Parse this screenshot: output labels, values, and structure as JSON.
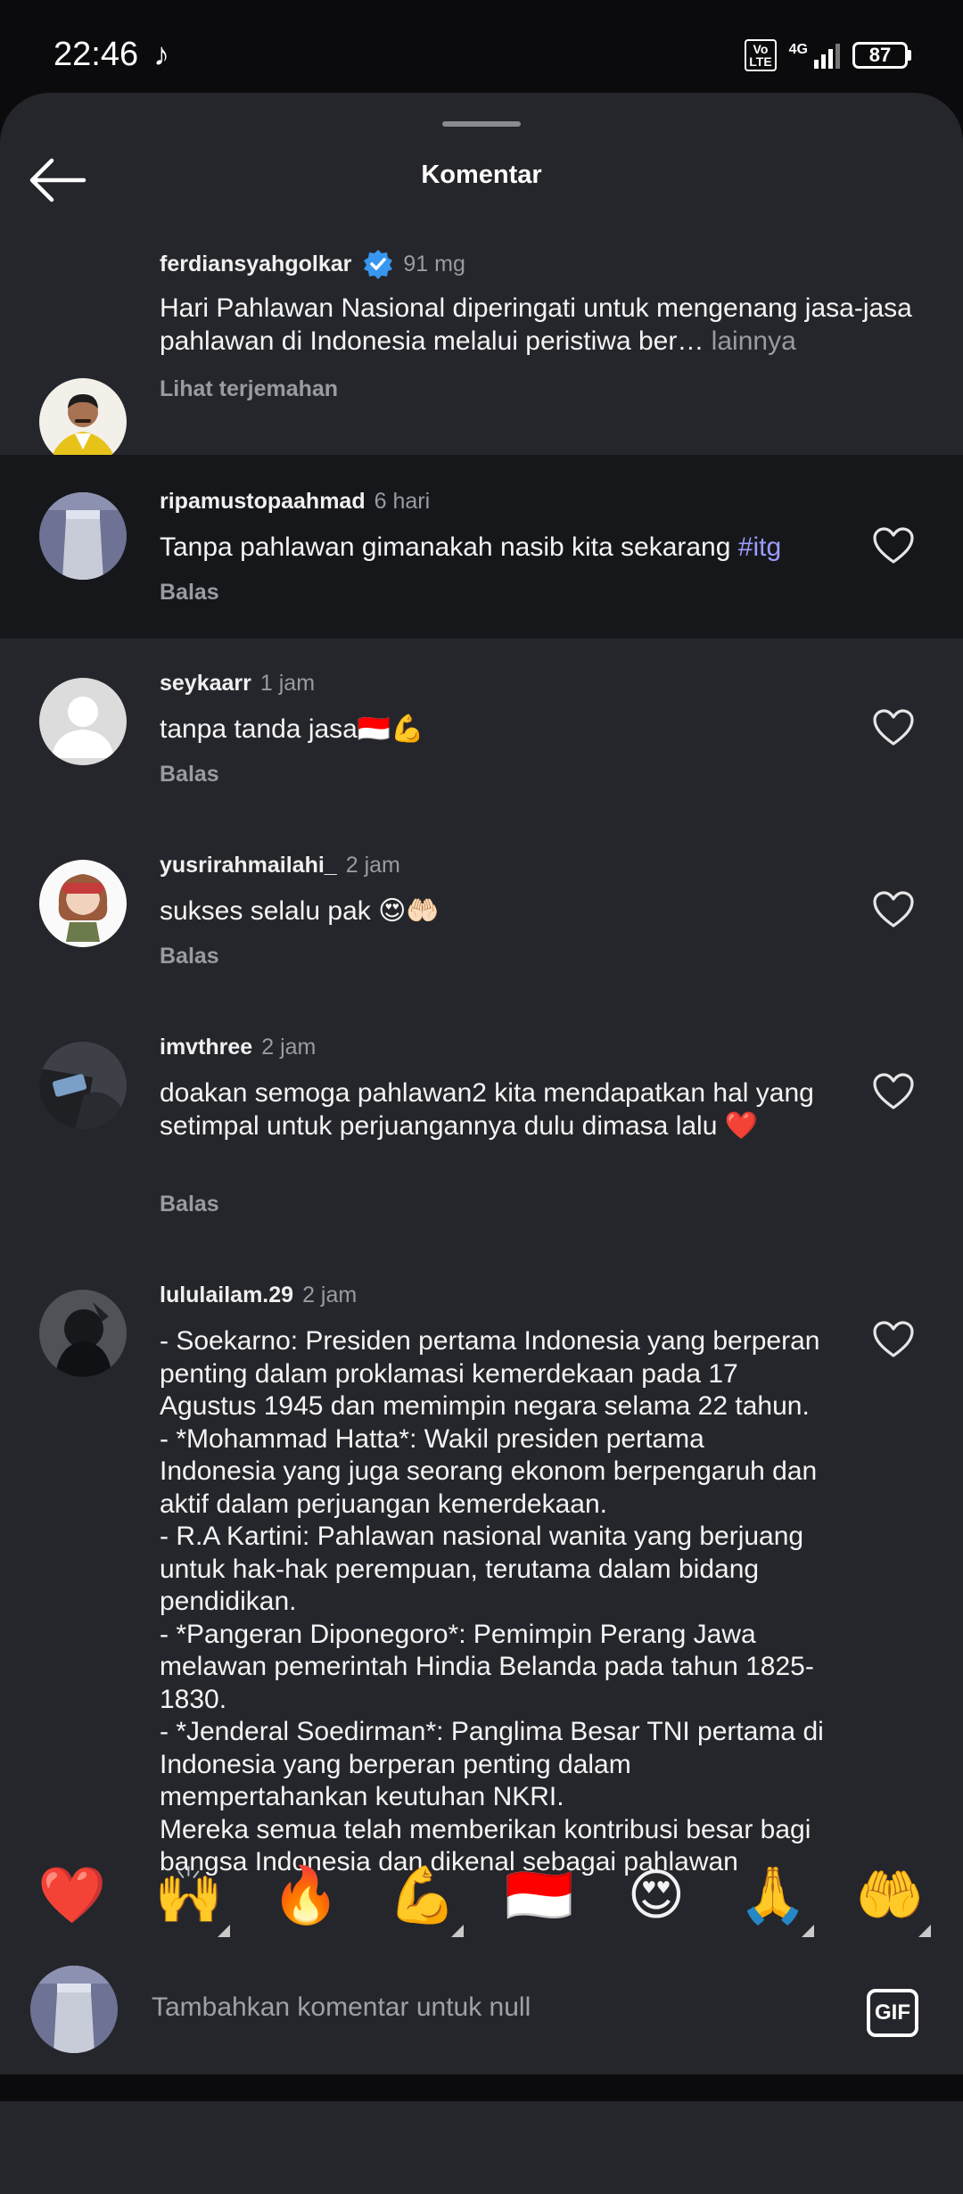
{
  "status_bar": {
    "time": "22:46",
    "network_label": "4G",
    "volte": "Vo LTE",
    "battery": "87"
  },
  "header": {
    "title": "Komentar"
  },
  "caption": {
    "username": "ferdiansyahgolkar",
    "time": "91 mg",
    "text": "Hari Pahlawan Nasional diperingati untuk mengenang jasa-jasa pahlawan di Indonesia melalui peristiwa ber…",
    "more": " lainnya",
    "translate": "Lihat terjemahan"
  },
  "comments": [
    {
      "username": "ripamustopaahmad",
      "time": "6 hari",
      "text": "Tanpa pahlawan gimanakah nasib kita sekarang ",
      "hashtag": "#itg",
      "reply": "Balas"
    },
    {
      "username": "seykaarr",
      "time": "1 jam",
      "text": "tanpa tanda jasa🇮🇩💪",
      "reply": "Balas"
    },
    {
      "username": "yusrirahmailahi_",
      "time": "2 jam",
      "text": "sukses selalu pak 😍🤲🏻",
      "reply": "Balas"
    },
    {
      "username": "imvthree",
      "time": "2 jam",
      "text": "doakan semoga pahlawan2 kita mendapatkan hal yang setimpal untuk perjuangannya dulu dimasa lalu ❤️",
      "reply": "Balas"
    },
    {
      "username": "lululailam.29",
      "time": "2 jam",
      "lines": [
        "- Soekarno: Presiden pertama Indonesia yang berperan penting dalam proklamasi kemerdekaan pada 17 Agustus 1945 dan memimpin negara selama 22 tahun.",
        "- *Mohammad Hatta*: Wakil presiden pertama Indonesia yang juga seorang ekonom berpengaruh dan aktif dalam perjuangan kemerdekaan.",
        "- R.A Kartini: Pahlawan nasional wanita yang berjuang untuk hak-hak perempuan, terutama dalam bidang pendidikan.",
        "- *Pangeran Diponegoro*: Pemimpin Perang Jawa melawan pemerintah Hindia Belanda pada tahun 1825-1830.",
        "- *Jenderal Soedirman*: Panglima Besar TNI pertama di Indonesia yang berperan penting dalam mempertahankan keutuhan NKRI.",
        "Mereka semua telah memberikan kontribusi besar bagi bangsa Indonesia dan dikenal sebagai pahlawan"
      ]
    }
  ],
  "emoji_bar": [
    "❤️",
    "🙌",
    "🔥",
    "💪",
    "🇮🇩",
    "😍",
    "🙏",
    "🤲"
  ],
  "compose": {
    "placeholder": "Tambahkan komentar untuk null",
    "gif_label": "GIF"
  },
  "colors": {
    "sheet_bg": "#25262b",
    "highlight_bg": "#16171a",
    "hashtag": "#9b9bff",
    "verified": "#3797f0"
  }
}
